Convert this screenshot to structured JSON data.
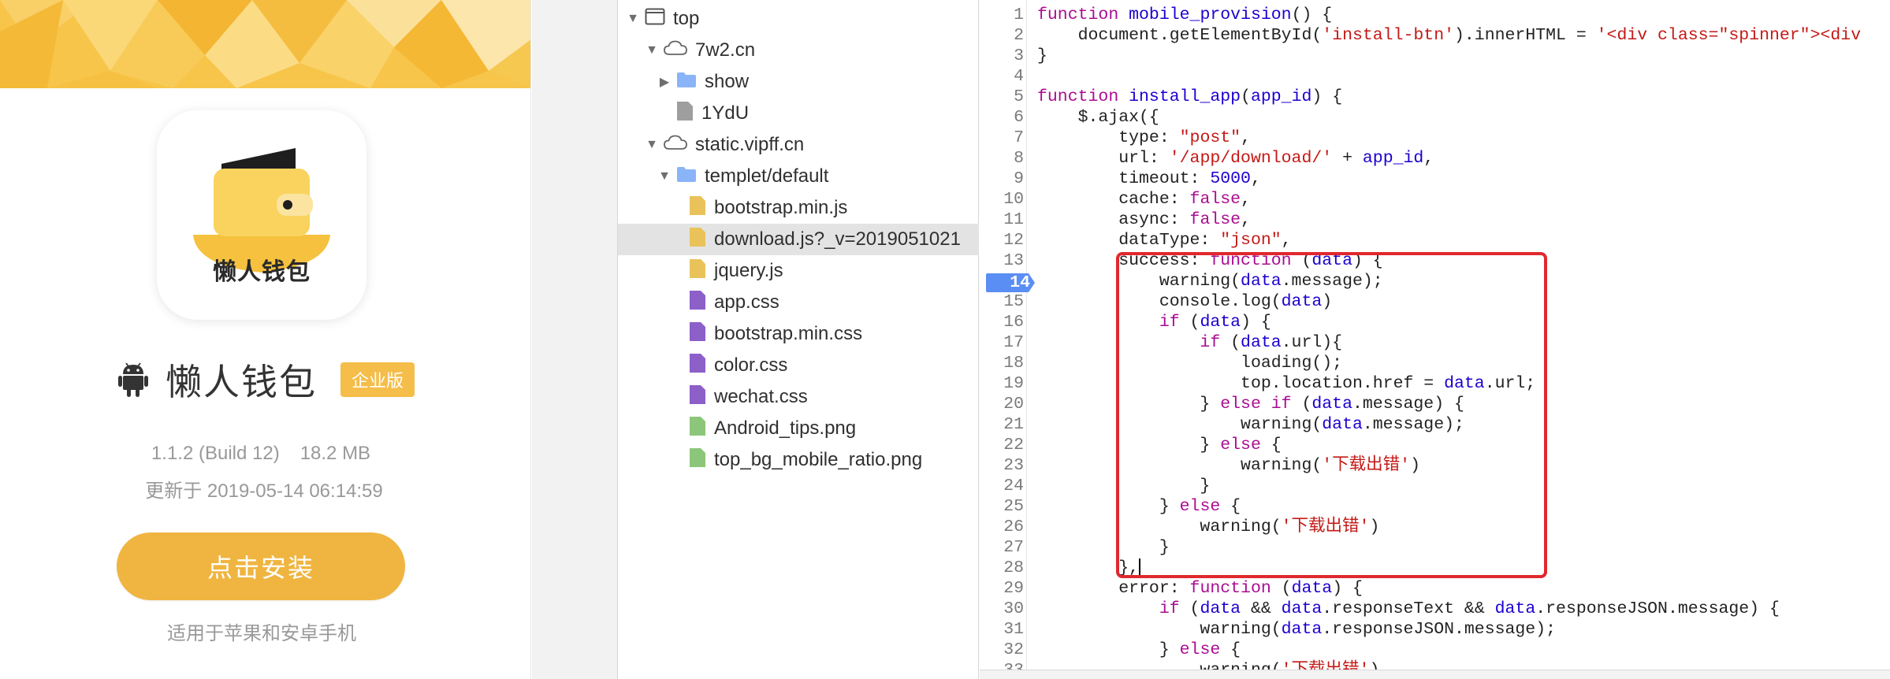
{
  "mobile": {
    "icon_caption": "懒人钱包",
    "app_name": "懒人钱包",
    "edition_badge": "企业版",
    "version": "1.1.2 (Build 12)",
    "size": "18.2 MB",
    "updated": "更新于 2019-05-14 06:14:59",
    "install_label": "点击安装",
    "compat_note": "适用于苹果和安卓手机",
    "colors": {
      "accent": "#f0b540",
      "banner": "#f7c54a"
    }
  },
  "tree": {
    "items": [
      {
        "label": "top",
        "icon": "window-icon",
        "expand": "expanded"
      },
      {
        "label": "7w2.cn",
        "icon": "cloud-icon",
        "expand": "expanded"
      },
      {
        "label": "show",
        "icon": "folder-icon",
        "expand": "collapsed"
      },
      {
        "label": "1YdU",
        "icon": "file-icon",
        "expand": "none"
      },
      {
        "label": "static.vipff.cn",
        "icon": "cloud-icon",
        "expand": "expanded"
      },
      {
        "label": "templet/default",
        "icon": "folder-icon",
        "expand": "expanded"
      },
      {
        "label": "bootstrap.min.js",
        "icon": "js-file-icon",
        "expand": "none"
      },
      {
        "label": "download.js?_v=2019051021",
        "icon": "js-file-icon",
        "expand": "none",
        "selected": true
      },
      {
        "label": "jquery.js",
        "icon": "js-file-icon",
        "expand": "none"
      },
      {
        "label": "app.css",
        "icon": "css-file-icon",
        "expand": "none"
      },
      {
        "label": "bootstrap.min.css",
        "icon": "css-file-icon",
        "expand": "none"
      },
      {
        "label": "color.css",
        "icon": "css-file-icon",
        "expand": "none"
      },
      {
        "label": "wechat.css",
        "icon": "css-file-icon",
        "expand": "none"
      },
      {
        "label": "Android_tips.png",
        "icon": "image-file-icon",
        "expand": "none"
      },
      {
        "label": "top_bg_mobile_ratio.png",
        "icon": "image-file-icon",
        "expand": "none"
      }
    ]
  },
  "editor": {
    "breakpoint_line": 14,
    "lines": [
      {
        "n": "1",
        "tokens": [
          [
            "kw",
            "function "
          ],
          [
            "fn",
            "mobile_provision"
          ],
          [
            "plain",
            "() {"
          ]
        ]
      },
      {
        "n": "2",
        "tokens": [
          [
            "plain",
            "    document.getElementById("
          ],
          [
            "str",
            "'install-btn'"
          ],
          [
            "plain",
            ").innerHTML = "
          ],
          [
            "str",
            "'<div class=\"spinner\"><div"
          ]
        ]
      },
      {
        "n": "3",
        "tokens": [
          [
            "plain",
            "}"
          ]
        ]
      },
      {
        "n": "4",
        "tokens": []
      },
      {
        "n": "5",
        "tokens": [
          [
            "kw",
            "function "
          ],
          [
            "fn",
            "install_app"
          ],
          [
            "plain",
            "("
          ],
          [
            "prop",
            "app_id"
          ],
          [
            "plain",
            ") {"
          ]
        ]
      },
      {
        "n": "6",
        "tokens": [
          [
            "plain",
            "    $.ajax({"
          ]
        ]
      },
      {
        "n": "7",
        "tokens": [
          [
            "plain",
            "        type: "
          ],
          [
            "str",
            "\"post\""
          ],
          [
            "plain",
            ","
          ]
        ]
      },
      {
        "n": "8",
        "tokens": [
          [
            "plain",
            "        url: "
          ],
          [
            "str",
            "'/app/download/'"
          ],
          [
            "plain",
            " + "
          ],
          [
            "prop",
            "app_id"
          ],
          [
            "plain",
            ","
          ]
        ]
      },
      {
        "n": "9",
        "tokens": [
          [
            "plain",
            "        timeout: "
          ],
          [
            "num",
            "5000"
          ],
          [
            "plain",
            ","
          ]
        ]
      },
      {
        "n": "10",
        "tokens": [
          [
            "plain",
            "        cache: "
          ],
          [
            "kw",
            "false"
          ],
          [
            "plain",
            ","
          ]
        ]
      },
      {
        "n": "11",
        "tokens": [
          [
            "plain",
            "        async: "
          ],
          [
            "kw",
            "false"
          ],
          [
            "plain",
            ","
          ]
        ]
      },
      {
        "n": "12",
        "tokens": [
          [
            "plain",
            "        dataType: "
          ],
          [
            "str",
            "\"json\""
          ],
          [
            "plain",
            ","
          ]
        ]
      },
      {
        "n": "13",
        "tokens": [
          [
            "plain",
            "        success: "
          ],
          [
            "kw",
            "function "
          ],
          [
            "plain",
            "("
          ],
          [
            "prop",
            "data"
          ],
          [
            "plain",
            ") {"
          ]
        ]
      },
      {
        "n": "14",
        "tokens": [
          [
            "plain",
            "            warning("
          ],
          [
            "prop",
            "data"
          ],
          [
            "plain",
            ".message);"
          ]
        ]
      },
      {
        "n": "15",
        "tokens": [
          [
            "plain",
            "            console.log("
          ],
          [
            "prop",
            "data"
          ],
          [
            "plain",
            ")"
          ]
        ]
      },
      {
        "n": "16",
        "tokens": [
          [
            "kw",
            "            if "
          ],
          [
            "plain",
            "("
          ],
          [
            "prop",
            "data"
          ],
          [
            "plain",
            ") {"
          ]
        ]
      },
      {
        "n": "17",
        "tokens": [
          [
            "kw",
            "                if "
          ],
          [
            "plain",
            "("
          ],
          [
            "prop",
            "data"
          ],
          [
            "plain",
            ".url){"
          ]
        ]
      },
      {
        "n": "18",
        "tokens": [
          [
            "plain",
            "                    loading();"
          ]
        ]
      },
      {
        "n": "19",
        "tokens": [
          [
            "plain",
            "                    top.location.href = "
          ],
          [
            "prop",
            "data"
          ],
          [
            "plain",
            ".url;"
          ]
        ]
      },
      {
        "n": "20",
        "tokens": [
          [
            "plain",
            "                } "
          ],
          [
            "kw",
            "else if "
          ],
          [
            "plain",
            "("
          ],
          [
            "prop",
            "data"
          ],
          [
            "plain",
            ".message) {"
          ]
        ]
      },
      {
        "n": "21",
        "tokens": [
          [
            "plain",
            "                    warning("
          ],
          [
            "prop",
            "data"
          ],
          [
            "plain",
            ".message);"
          ]
        ]
      },
      {
        "n": "22",
        "tokens": [
          [
            "plain",
            "                } "
          ],
          [
            "kw",
            "else "
          ],
          [
            "plain",
            "{"
          ]
        ]
      },
      {
        "n": "23",
        "tokens": [
          [
            "plain",
            "                    warning("
          ],
          [
            "str",
            "'下载出错'"
          ],
          [
            "plain",
            ")"
          ]
        ]
      },
      {
        "n": "24",
        "tokens": [
          [
            "plain",
            "                }"
          ]
        ]
      },
      {
        "n": "25",
        "tokens": [
          [
            "plain",
            "            } "
          ],
          [
            "kw",
            "else "
          ],
          [
            "plain",
            "{"
          ]
        ]
      },
      {
        "n": "26",
        "tokens": [
          [
            "plain",
            "                warning("
          ],
          [
            "str",
            "'下载出错'"
          ],
          [
            "plain",
            ")"
          ]
        ]
      },
      {
        "n": "27",
        "tokens": [
          [
            "plain",
            "            }"
          ]
        ]
      },
      {
        "n": "28",
        "tokens": [
          [
            "plain",
            "        },"
          ]
        ],
        "cursor": true
      },
      {
        "n": "29",
        "tokens": [
          [
            "plain",
            "        error: "
          ],
          [
            "kw",
            "function "
          ],
          [
            "plain",
            "("
          ],
          [
            "prop",
            "data"
          ],
          [
            "plain",
            ") {"
          ]
        ]
      },
      {
        "n": "30",
        "tokens": [
          [
            "kw",
            "            if "
          ],
          [
            "plain",
            "("
          ],
          [
            "prop",
            "data"
          ],
          [
            "plain",
            " && "
          ],
          [
            "prop",
            "data"
          ],
          [
            "plain",
            ".responseText && "
          ],
          [
            "prop",
            "data"
          ],
          [
            "plain",
            ".responseJSON.message) {"
          ]
        ]
      },
      {
        "n": "31",
        "tokens": [
          [
            "plain",
            "                warning("
          ],
          [
            "prop",
            "data"
          ],
          [
            "plain",
            ".responseJSON.message);"
          ]
        ]
      },
      {
        "n": "32",
        "tokens": [
          [
            "plain",
            "            } "
          ],
          [
            "kw",
            "else "
          ],
          [
            "plain",
            "{"
          ]
        ]
      },
      {
        "n": "33",
        "tokens": [
          [
            "plain",
            "                warning("
          ],
          [
            "str",
            "'下载出错'"
          ],
          [
            "plain",
            ")"
          ]
        ]
      }
    ]
  }
}
